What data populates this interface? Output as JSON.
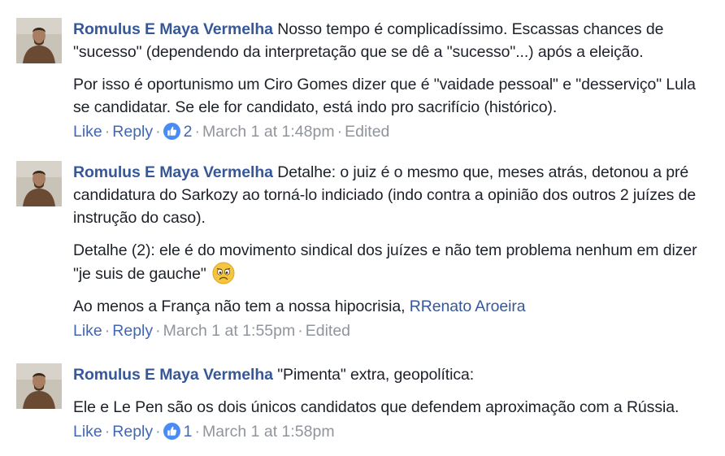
{
  "comments": [
    {
      "author": "Romulus E Maya Vermelha",
      "paragraphs": [
        "Nosso tempo é complicadíssimo. Escassas chances de \"sucesso\" (dependendo da interpretação que se dê a \"sucesso\"...) após a eleição.",
        "Por isso é oportunismo um Ciro Gomes dizer que é \"vaidade pessoal\" e \"desserviço\" Lula se candidatar. Se ele for candidato, está indo pro sacrifício (histórico)."
      ],
      "like_label": "Like",
      "reply_label": "Reply",
      "reaction_icon": "like-reaction-icon",
      "reaction_count": "2",
      "timestamp": "March 1 at 1:48pm",
      "edited": "Edited"
    },
    {
      "author": "Romulus E Maya Vermelha",
      "p1": "Detalhe: o juiz é o mesmo que, meses atrás, detonou a pré candidatura do Sarkozy ao torná-lo indiciado (indo contra a opinião dos outros 2 juízes de instrução do caso).",
      "p2": "Detalhe (2): ele é do movimento sindical dos juízes e não tem problema nenhum em dizer \"je suis de gauche\"",
      "p2_emoji": "frowning-face-emoji",
      "p3_text": "Ao menos a França não tem a nossa hipocrisia,",
      "p3_mention": "RRenato Aroeira",
      "like_label": "Like",
      "reply_label": "Reply",
      "timestamp": "March 1 at 1:55pm",
      "edited": "Edited"
    },
    {
      "author": "Romulus E Maya Vermelha",
      "paragraphs": [
        "\"Pimenta\" extra, geopolítica:",
        "Ele e Le Pen são os dois únicos candidatos que defendem aproximação com a Rússia."
      ],
      "like_label": "Like",
      "reply_label": "Reply",
      "reaction_icon": "like-reaction-icon",
      "reaction_count": "1",
      "timestamp": "March 1 at 1:58pm"
    }
  ],
  "colors": {
    "link": "#365899",
    "action": "#4267b2",
    "meta": "#90949c",
    "text": "#1d2129"
  }
}
